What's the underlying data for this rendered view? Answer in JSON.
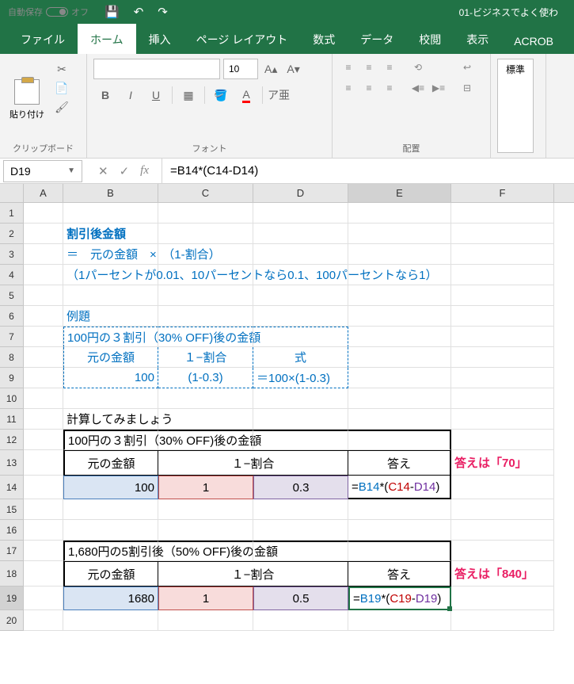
{
  "titlebar": {
    "autosave_label": "自動保存",
    "autosave_state": "オフ",
    "filename": "01-ビジネスでよく使わ"
  },
  "tabs": {
    "file": "ファイル",
    "home": "ホーム",
    "insert": "挿入",
    "page_layout": "ページ レイアウト",
    "formulas": "数式",
    "data": "データ",
    "review": "校閲",
    "view": "表示",
    "acrobat": "ACROB"
  },
  "ribbon": {
    "clipboard": {
      "paste": "貼り付け",
      "group": "クリップボード"
    },
    "font": {
      "size": "10",
      "group": "フォント",
      "bold": "B",
      "italic": "I",
      "underline": "U"
    },
    "alignment": {
      "group": "配置"
    },
    "style": {
      "normal": "標準"
    }
  },
  "formulabar": {
    "name_box": "D19",
    "formula": "=B14*(C14-D14)"
  },
  "columns": [
    "A",
    "B",
    "C",
    "D",
    "E",
    "F"
  ],
  "rows": [
    "1",
    "2",
    "3",
    "4",
    "5",
    "6",
    "7",
    "8",
    "9",
    "10",
    "11",
    "12",
    "13",
    "14",
    "15",
    "16",
    "17",
    "18",
    "19",
    "20"
  ],
  "sheet": {
    "r2_b": "割引後金額",
    "r3_b": "＝　元の金額　×　（1-割合）",
    "r4_b": "（1パーセントが0.01、10パーセントなら0.1、100パーセントなら1）",
    "r6_b": "例題",
    "r7_b": "100円の３割引（30% OFF)後の金額",
    "r8_b": "元の金額",
    "r8_c": "１−割合",
    "r8_d": "式",
    "r9_b": "100",
    "r9_c": "(1-0.3)",
    "r9_d": "＝100×(1-0.3)",
    "r11_b": "計算してみましょう",
    "r12_b": "100円の３割引（30% OFF)後の金額",
    "r13_b": "元の金額",
    "r13_c": "１−割合",
    "r13_e": "答え",
    "r13_f": "答えは「70」",
    "r14_b": "100",
    "r14_c": "1",
    "r14_d": "0.3",
    "r14_e_pre": "=",
    "r14_e_b": "B14",
    "r14_e_op1": "*(",
    "r14_e_c": "C14",
    "r14_e_op2": "-",
    "r14_e_d": "D14",
    "r14_e_op3": ")",
    "r17_b": "1,680円の5割引後（50% OFF)後の金額",
    "r18_b": "元の金額",
    "r18_c": "１−割合",
    "r18_e": "答え",
    "r18_f": "答えは「840」",
    "r19_b": "1680",
    "r19_c": "1",
    "r19_d": "0.5",
    "r19_e_pre": "=",
    "r19_e_b": "B19",
    "r19_e_op1": "*(",
    "r19_e_c": "C19",
    "r19_e_op2": "-",
    "r19_e_d": "D19",
    "r19_e_op3": ")"
  }
}
